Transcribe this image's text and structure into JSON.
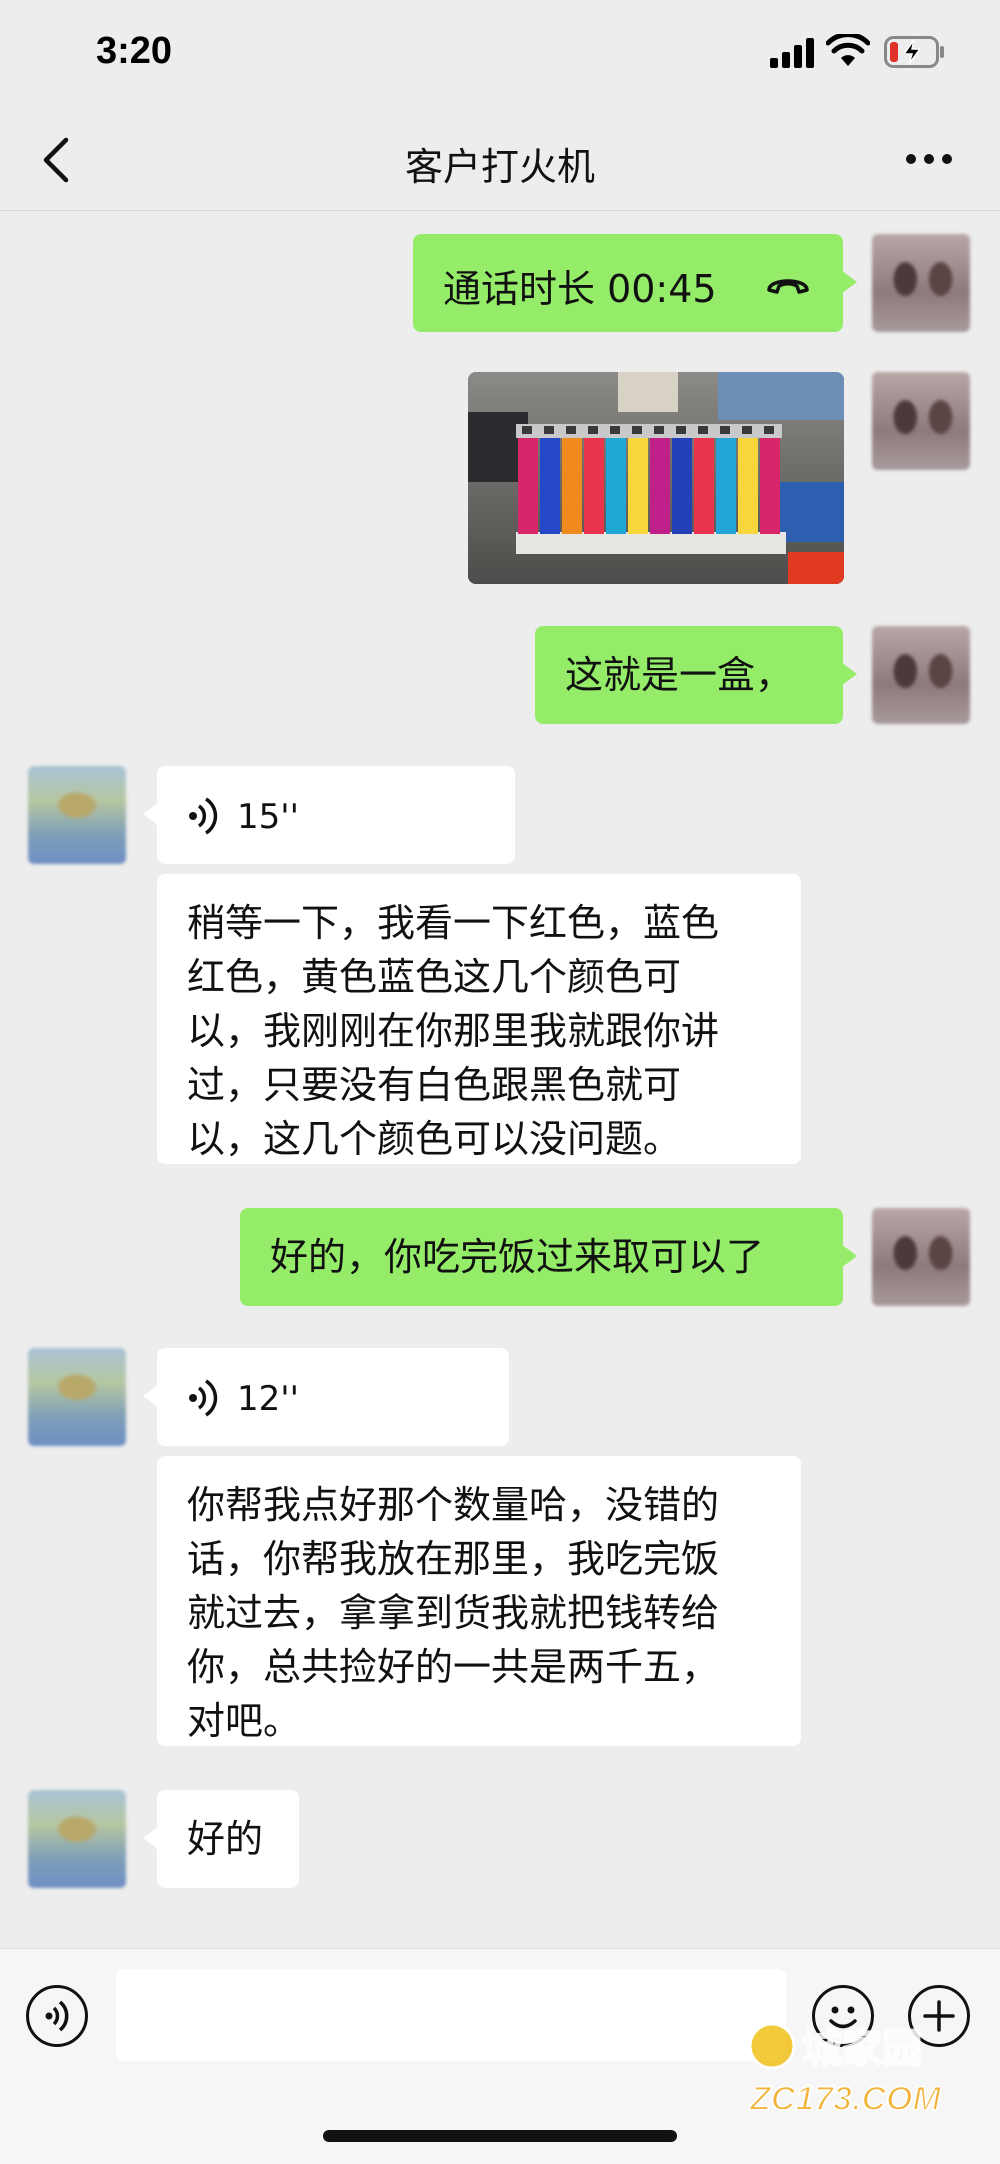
{
  "status_bar": {
    "time": "3:20"
  },
  "header": {
    "title": "客户打火机"
  },
  "messages": {
    "call": {
      "label": "通话时长 00:45"
    },
    "text1": {
      "text": "这就是一盒，"
    },
    "voice1": {
      "duration": "15''"
    },
    "text2": {
      "lines": [
        "稍等一下，我看一下红色，蓝色",
        "红色，黄色蓝色这几个颜色可",
        "以，我刚刚在你那里我就跟你讲",
        "过，只要没有白色跟黑色就可",
        "以，这几个颜色可以没问题。"
      ]
    },
    "text3": {
      "text": "好的，你吃完饭过来取可以了"
    },
    "voice2": {
      "duration": "12''"
    },
    "text4": {
      "lines": [
        "你帮我点好那个数量哈，没错的",
        "话，你帮我放在那里，我吃完饭",
        "就过去，拿拿到货我就把钱转给",
        "你，总共捡好的一共是两千五，",
        "对吧。"
      ]
    },
    "text5": {
      "text": "好的"
    }
  },
  "watermark": {
    "text": "ZC173.COM",
    "logo": "城家园"
  },
  "colors": {
    "sent_bubble": "#95ec69",
    "received_bubble": "#ffffff",
    "background": "#ededed"
  }
}
